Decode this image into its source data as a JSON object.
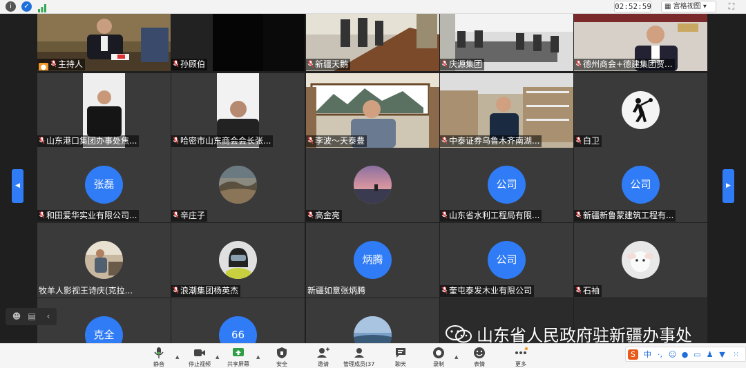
{
  "window": {
    "timer": "02:52:59",
    "view_mode": "宫格视图",
    "icon_colors": {
      "info": "#555555",
      "shield": "#1e6fd9",
      "signal": "#34a853"
    }
  },
  "participants": [
    {
      "name": "主持人",
      "kind": "video",
      "host": true
    },
    {
      "name": "孙顾伯",
      "kind": "video"
    },
    {
      "name": "新疆天鹅",
      "kind": "video"
    },
    {
      "name": "庆源集团",
      "kind": "video"
    },
    {
      "name": "德州商会+德建集团贾...",
      "kind": "video"
    },
    {
      "name": "山东港口集团办事处焦...",
      "kind": "video"
    },
    {
      "name": "哈密市山东商会会长张...",
      "kind": "video"
    },
    {
      "name": "李波～天泰豊",
      "kind": "video"
    },
    {
      "name": "中泰证券乌鲁木齐南湖...",
      "kind": "video"
    },
    {
      "name": "白卫",
      "kind": "avatar-image",
      "avatar_icon": "figure-icon"
    },
    {
      "name": "和田爱华实业有限公司...",
      "kind": "avatar-text",
      "avatar": "张磊"
    },
    {
      "name": "辛庄子",
      "kind": "avatar-image",
      "avatar_icon": "landscape-icon"
    },
    {
      "name": "高金亮",
      "kind": "avatar-image",
      "avatar_icon": "sunset-icon"
    },
    {
      "name": "山东省水利工程局有限...",
      "kind": "avatar-text",
      "avatar": "公司"
    },
    {
      "name": "新疆新鲁蒙建筑工程有...",
      "kind": "avatar-text",
      "avatar": "公司"
    },
    {
      "name": "牧羊人影视王诗庆(克拉...",
      "kind": "avatar-image",
      "avatar_icon": "person-icon",
      "muted": false
    },
    {
      "name": "浪潮集团杨英杰",
      "kind": "avatar-image",
      "avatar_icon": "helmet-icon"
    },
    {
      "name": "新疆如意张炳腾",
      "kind": "avatar-text",
      "avatar": "炳腾",
      "muted": false
    },
    {
      "name": "奎屯泰发木业有限公司",
      "kind": "avatar-text",
      "avatar": "公司"
    },
    {
      "name": "石袖",
      "kind": "avatar-image",
      "avatar_icon": "lamb-icon"
    },
    {
      "name": "",
      "kind": "avatar-text",
      "avatar": "克全"
    },
    {
      "name": "",
      "kind": "avatar-text",
      "avatar": "66"
    },
    {
      "name": "",
      "kind": "avatar-image",
      "avatar_icon": "sky-icon"
    },
    {
      "name": "",
      "kind": "empty"
    },
    {
      "name": "",
      "kind": "empty"
    }
  ],
  "host_badge": "主持人",
  "watermark": "山东省人民政府驻新疆办事处",
  "toolbar": {
    "items": [
      {
        "label": "静音",
        "icon": "microphone-icon"
      },
      {
        "label": "停止视频",
        "icon": "camera-icon"
      },
      {
        "label": "共享屏幕",
        "icon": "share-screen-icon"
      },
      {
        "label": "安全",
        "icon": "shield-icon"
      },
      {
        "label": "邀请",
        "icon": "invite-icon"
      },
      {
        "label": "管理成员(37)",
        "icon": "members-icon"
      },
      {
        "label": "聊天",
        "icon": "chat-icon"
      },
      {
        "label": "录制",
        "icon": "record-icon"
      },
      {
        "label": "表情",
        "icon": "emoji-icon"
      },
      {
        "label": "更多",
        "icon": "more-icon"
      }
    ]
  },
  "ime": {
    "lang": "中"
  },
  "colors": {
    "accent": "#2f7cf6",
    "active_border": "#55c24b",
    "mic_red": "#e03a3a"
  }
}
